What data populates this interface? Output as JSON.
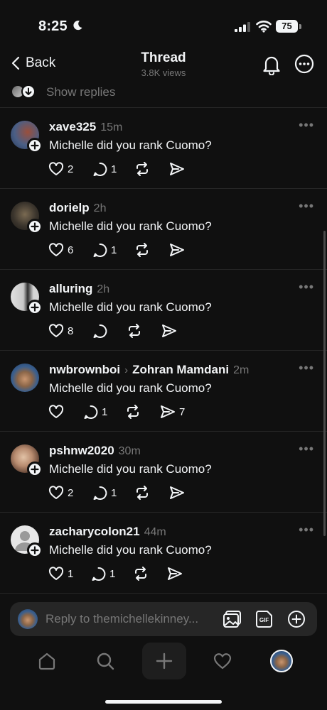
{
  "status": {
    "time": "8:25",
    "battery": "75"
  },
  "nav": {
    "back_label": "Back",
    "title": "Thread",
    "views": "3.8K views"
  },
  "show_replies_label": "Show replies",
  "posts": [
    {
      "username": "xave325",
      "time": "15m",
      "text": "Michelle did you rank Cuomo?",
      "likes": "2",
      "replies": "1",
      "shares": "",
      "avatar_colors": [
        "#8b4a3a",
        "#3d5d8a"
      ]
    },
    {
      "username": "dorielp",
      "time": "2h",
      "text": "Michelle did you rank Cuomo?",
      "likes": "6",
      "replies": "1",
      "shares": "",
      "avatar_colors": [
        "#2c2a26",
        "#8a7a60"
      ]
    },
    {
      "username": "alluring",
      "time": "2h",
      "text": "Michelle did you rank Cuomo?",
      "likes": "8",
      "replies": "",
      "shares": "",
      "avatar_colors": [
        "#d8d8d8",
        "#2a2a2a"
      ]
    },
    {
      "username": "nwbrownboi",
      "reply_to": "Zohran Mamdani",
      "time": "2m",
      "text": "Michelle did you rank Cuomo?",
      "likes": "",
      "replies": "1",
      "shares": "7",
      "avatar_colors": [
        "#3a5f8e",
        "#c99670"
      ]
    },
    {
      "username": "pshnw2020",
      "time": "30m",
      "text": "Michelle did you rank Cuomo?",
      "likes": "2",
      "replies": "1",
      "shares": "",
      "avatar_colors": [
        "#c6a38a",
        "#6b4a3b"
      ]
    },
    {
      "username": "zacharycolon21",
      "time": "44m",
      "text": "Michelle did you rank Cuomo?",
      "likes": "1",
      "replies": "1",
      "shares": "",
      "avatar_colors": [
        "#e7e7e7",
        "#9a9a9a"
      ]
    }
  ],
  "reply_bar": {
    "placeholder": "Reply to themichellekinney..."
  },
  "colors": {
    "background": "#101010",
    "text": "#f3f5f7",
    "muted": "#777777",
    "divider": "#262626"
  }
}
